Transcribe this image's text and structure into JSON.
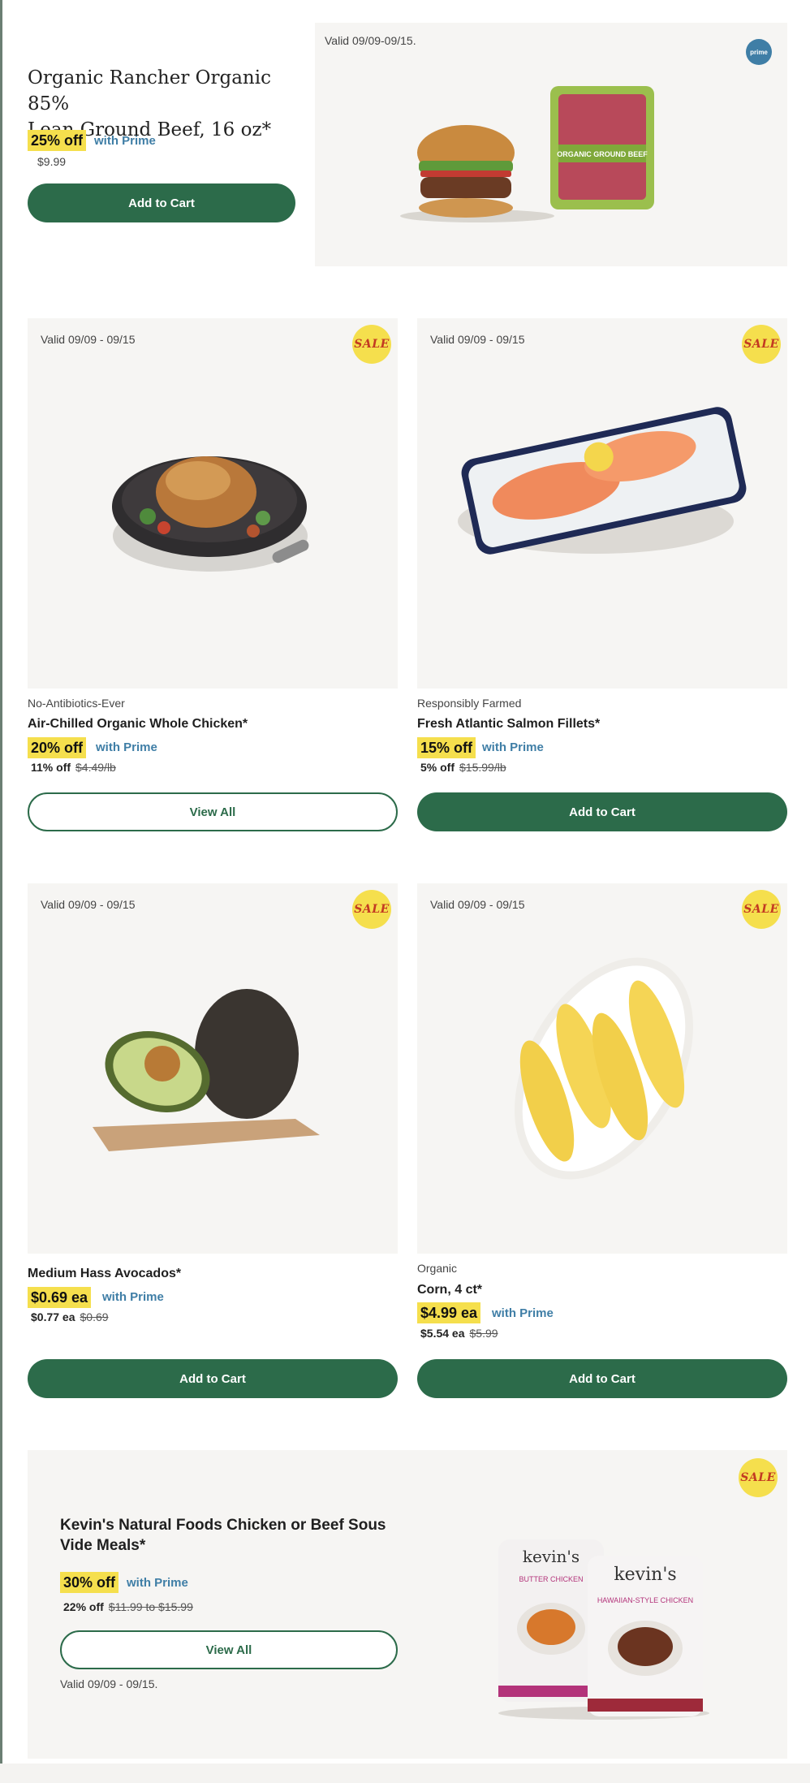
{
  "hero": {
    "title_line1": "Organic Rancher Organic 85%",
    "title_line2": "Lean Ground Beef, 16 oz*",
    "deal": "25% off",
    "prime": "with Prime",
    "price": "$9.99",
    "button": "Add to Cart",
    "valid": "Valid 09/09-09/15.",
    "prime_badge": "prime",
    "package_label": "ORGANIC GROUND BEEF"
  },
  "products": [
    {
      "valid": "Valid 09/09 - 09/15",
      "badge": "SALE",
      "subtitle": "No-Antibiotics-Ever",
      "title": "Air-Chilled Organic Whole Chicken*",
      "deal": "20% off",
      "prime": "with Prime",
      "price_now": "11% off",
      "price_was": "$4.49/lb",
      "button": "View All",
      "button_style": "outline",
      "image": "roast-chicken-in-skillet"
    },
    {
      "valid": "Valid 09/09 - 09/15",
      "badge": "SALE",
      "subtitle": "Responsibly Farmed",
      "title": "Fresh Atlantic Salmon Fillets*",
      "deal": "15% off",
      "prime": "with Prime",
      "price_now": "5% off",
      "price_was": "$15.99/lb",
      "button": "Add to Cart",
      "button_style": "solid",
      "image": "salmon-on-ice-tray"
    },
    {
      "valid": "Valid 09/09 - 09/15",
      "badge": "SALE",
      "subtitle": "",
      "title": "Medium Hass Avocados*",
      "deal": "$0.69 ea",
      "prime": "with Prime",
      "price_now": "$0.77 ea",
      "price_was": "$0.69",
      "button": "Add to Cart",
      "button_style": "solid",
      "image": "avocados-on-board"
    },
    {
      "valid": "Valid 09/09 - 09/15",
      "badge": "SALE",
      "subtitle": "Organic",
      "title": "Corn, 4 ct*",
      "deal": "$4.99 ea",
      "prime": "with Prime",
      "price_now": "$5.54 ea",
      "price_was": "$5.99",
      "button": "Add to Cart",
      "button_style": "solid",
      "image": "corn-on-plate"
    }
  ],
  "promo": {
    "badge": "SALE",
    "title_line1": "Kevin's Natural Foods Chicken or Beef Sous",
    "title_line2": "Vide Meals*",
    "deal": "30% off",
    "prime": "with Prime",
    "price_now": "22% off",
    "price_was": "$11.99 to $15.99",
    "button": "View All",
    "valid": "Valid 09/09 - 09/15.",
    "pack1_brand": "kevin's",
    "pack1_name": "BUTTER CHICKEN",
    "pack2_brand": "kevin's",
    "pack2_name": "HAWAIIAN-STYLE CHICKEN"
  },
  "colors": {
    "accent_green": "#2c6b4a",
    "deal_yellow": "#f5df4d",
    "prime_blue": "#3f7ea6",
    "sale_red": "#c33a22",
    "panel_bg": "#f6f5f3"
  }
}
